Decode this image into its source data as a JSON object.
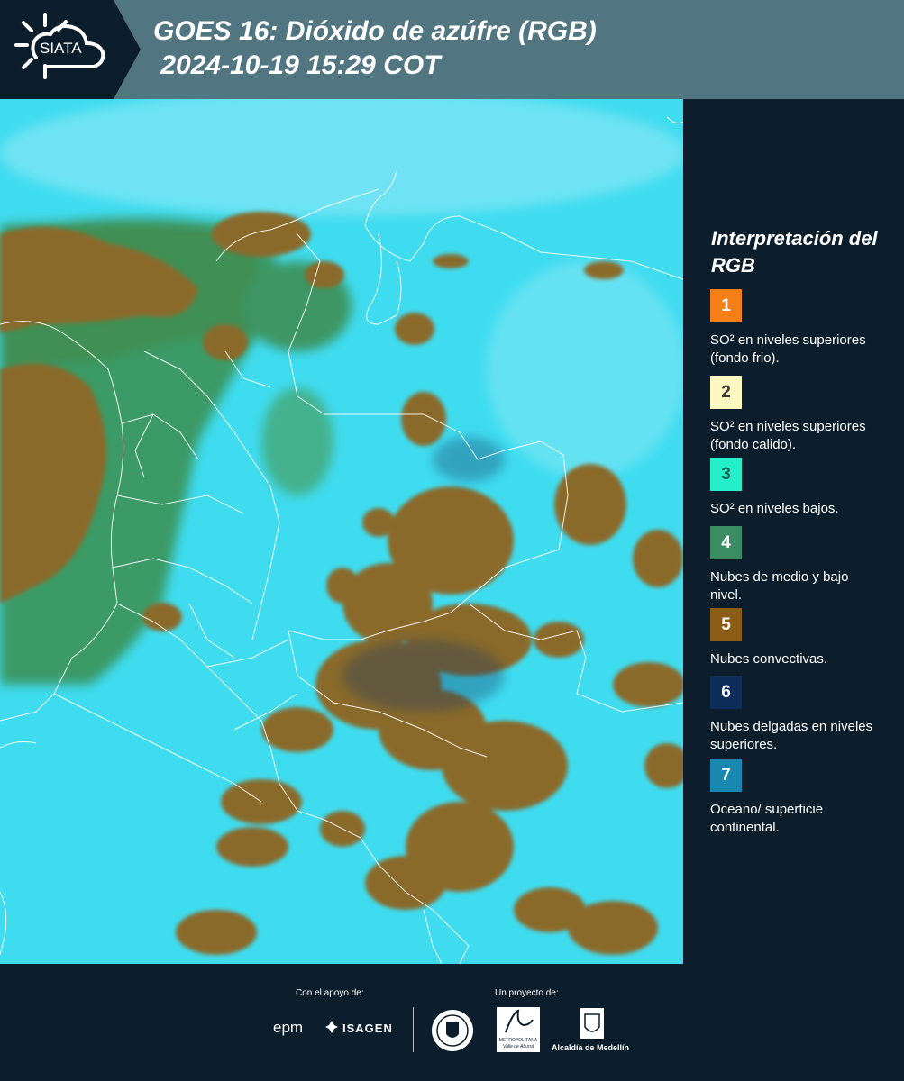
{
  "header": {
    "logo_text": "SIATA",
    "title_line1": "GOES 16: Dióxido de azúfre (RGB)",
    "title_line2": " 2024-10-19 15:29 COT"
  },
  "legend": {
    "title": "Interpretación del RGB",
    "items": [
      {
        "number": "1",
        "color": "#f37f16",
        "text_color": "#ffffff",
        "label": "SO² en niveles superiores (fondo frio)."
      },
      {
        "number": "2",
        "color": "#fdf7c2",
        "text_color": "#3a3a3a",
        "label": "SO² en niveles superiores (fondo calido)."
      },
      {
        "number": "3",
        "color": "#24efc9",
        "text_color": "#1a5c55",
        "label": "SO² en niveles bajos."
      },
      {
        "number": "4",
        "color": "#3a8c63",
        "text_color": "#ffffff",
        "label": "Nubes de medio y bajo nivel."
      },
      {
        "number": "5",
        "color": "#8a5c16",
        "text_color": "#ffffff",
        "label": "Nubes convectivas."
      },
      {
        "number": "6",
        "color": "#0f2d5a",
        "text_color": "#ffffff",
        "label": "Nubes delgadas en niveles superiores."
      },
      {
        "number": "7",
        "color": "#1888b0",
        "text_color": "#ffffff",
        "label": "Oceano/ superficie continental."
      }
    ]
  },
  "footer": {
    "support_label": "Con el apoyo de:",
    "project_label": "Un proyecto de:",
    "epm": "epm",
    "isagen": "ISAGEN",
    "area_metro_1": "METROPOLITANA",
    "area_metro_2": "Valle de Aburrá",
    "alcaldia": "Alcaldía de Medellín"
  }
}
